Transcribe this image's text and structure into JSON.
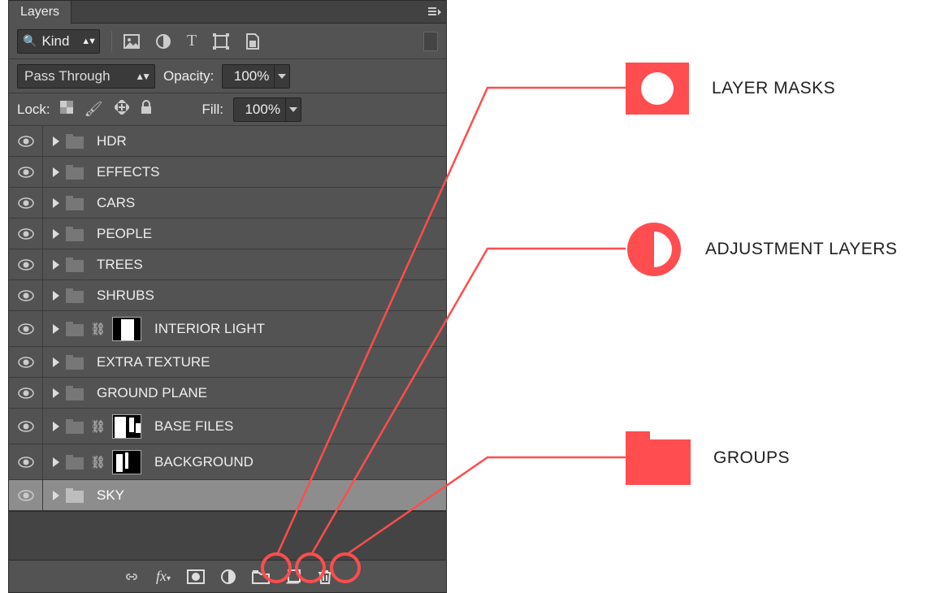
{
  "panel": {
    "title": "Layers"
  },
  "filter": {
    "kind_label": "Kind"
  },
  "blend": {
    "mode": "Pass Through",
    "opacity_label": "Opacity:",
    "opacity_value": "100%"
  },
  "lock": {
    "label": "Lock:",
    "fill_label": "Fill:",
    "fill_value": "100%"
  },
  "layers": [
    {
      "name": "HDR",
      "linked": false,
      "mask": null,
      "selected": false
    },
    {
      "name": "EFFECTS",
      "linked": false,
      "mask": null,
      "selected": false
    },
    {
      "name": "CARS",
      "linked": false,
      "mask": null,
      "selected": false
    },
    {
      "name": "PEOPLE",
      "linked": false,
      "mask": null,
      "selected": false
    },
    {
      "name": "TREES",
      "linked": false,
      "mask": null,
      "selected": false
    },
    {
      "name": "SHRUBS",
      "linked": false,
      "mask": null,
      "selected": false
    },
    {
      "name": "INTERIOR LIGHT",
      "linked": true,
      "mask": "interior",
      "selected": false
    },
    {
      "name": "EXTRA TEXTURE",
      "linked": false,
      "mask": null,
      "selected": false
    },
    {
      "name": "GROUND PLANE",
      "linked": false,
      "mask": null,
      "selected": false
    },
    {
      "name": "BASE FILES",
      "linked": true,
      "mask": "base",
      "selected": false
    },
    {
      "name": "BACKGROUND",
      "linked": true,
      "mask": "background",
      "selected": false
    },
    {
      "name": "SKY",
      "linked": false,
      "mask": null,
      "selected": true
    }
  ],
  "annotations": {
    "mask": "LAYER MASKS",
    "adjust": "ADJUSTMENT LAYERS",
    "groups": "GROUPS"
  }
}
